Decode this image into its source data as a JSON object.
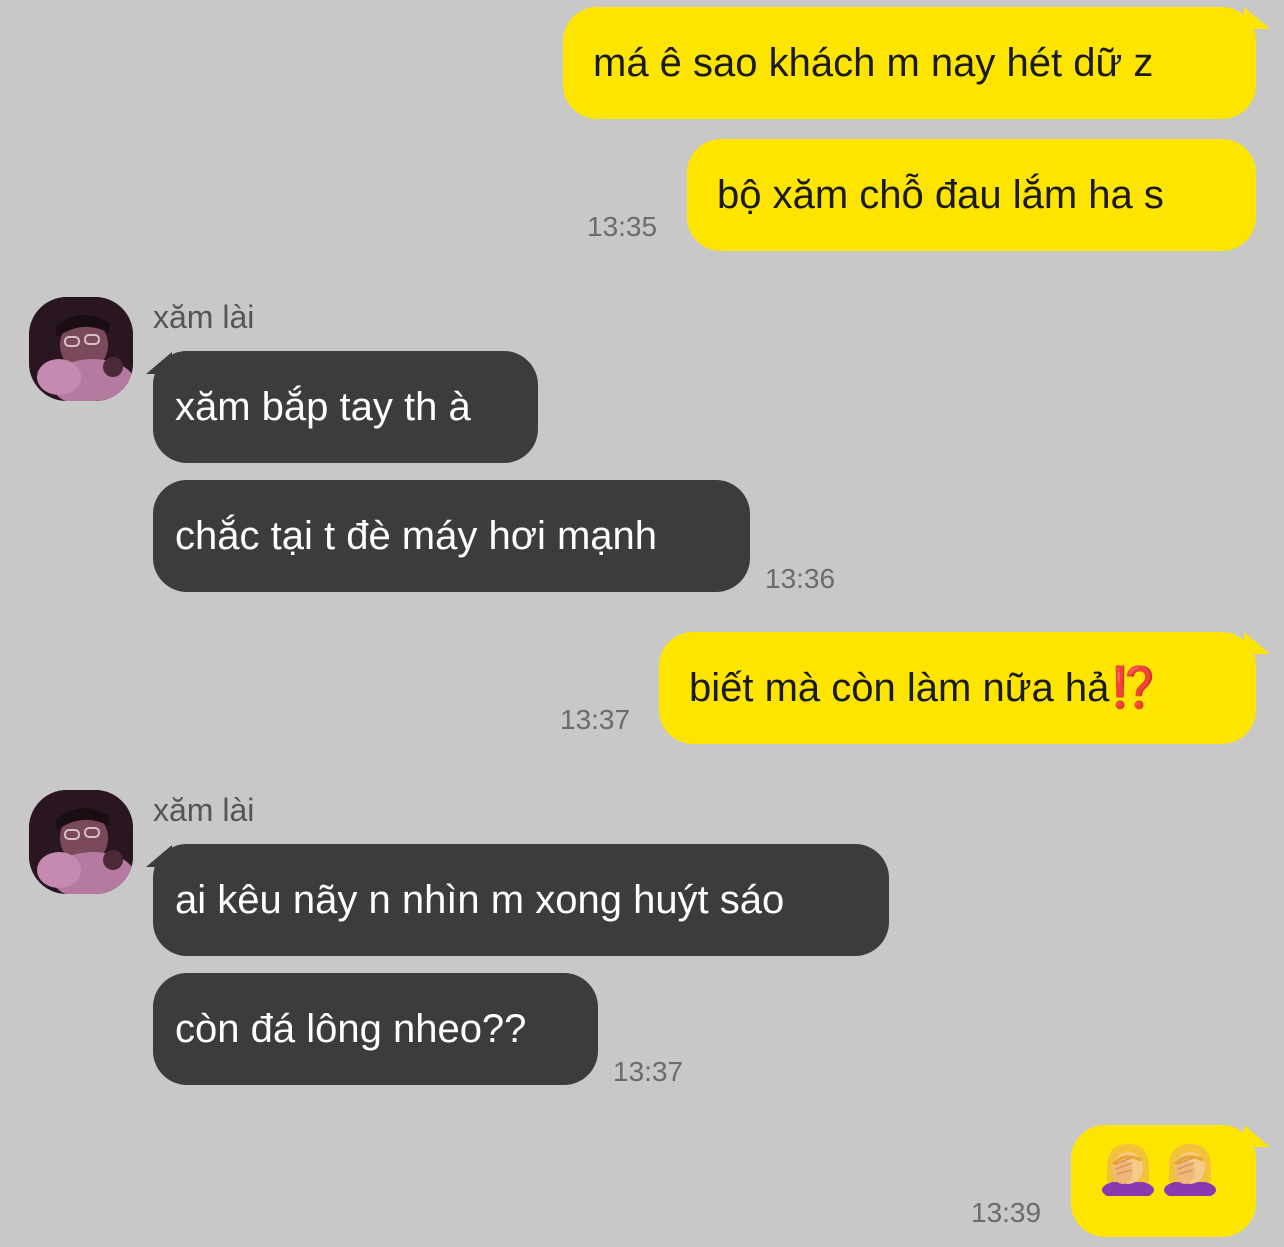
{
  "contact": {
    "name": "xăm lài",
    "avatar_icon": "person-avatar-icon"
  },
  "colors": {
    "background": "#c8c8c8",
    "outgoing_bubble": "#fee500",
    "incoming_bubble": "#3b3c3e",
    "timestamp": "#6b6b6b"
  },
  "messages": [
    {
      "dir": "out",
      "text": "má ê sao khách m nay hét dữ z"
    },
    {
      "dir": "out",
      "text": "bộ xăm chỗ đau lắm ha s",
      "time": "13:35"
    },
    {
      "dir": "in",
      "sender": "xăm lài",
      "text": "xăm bắp tay th à"
    },
    {
      "dir": "in",
      "text": "chắc tại t đè máy hơi mạnh",
      "time": "13:36"
    },
    {
      "dir": "out",
      "text": "biết mà còn làm nữa hả",
      "suffix": "⁉️",
      "time": "13:37"
    },
    {
      "dir": "in",
      "sender": "xăm lài",
      "text": "ai kêu nãy n nhìn m xong huýt sáo"
    },
    {
      "dir": "in",
      "text": "còn đá lông nheo??",
      "time": "13:37"
    },
    {
      "dir": "out",
      "emoji": [
        "woman-facepalming-icon",
        "woman-facepalming-icon"
      ],
      "time": "13:39"
    }
  ]
}
